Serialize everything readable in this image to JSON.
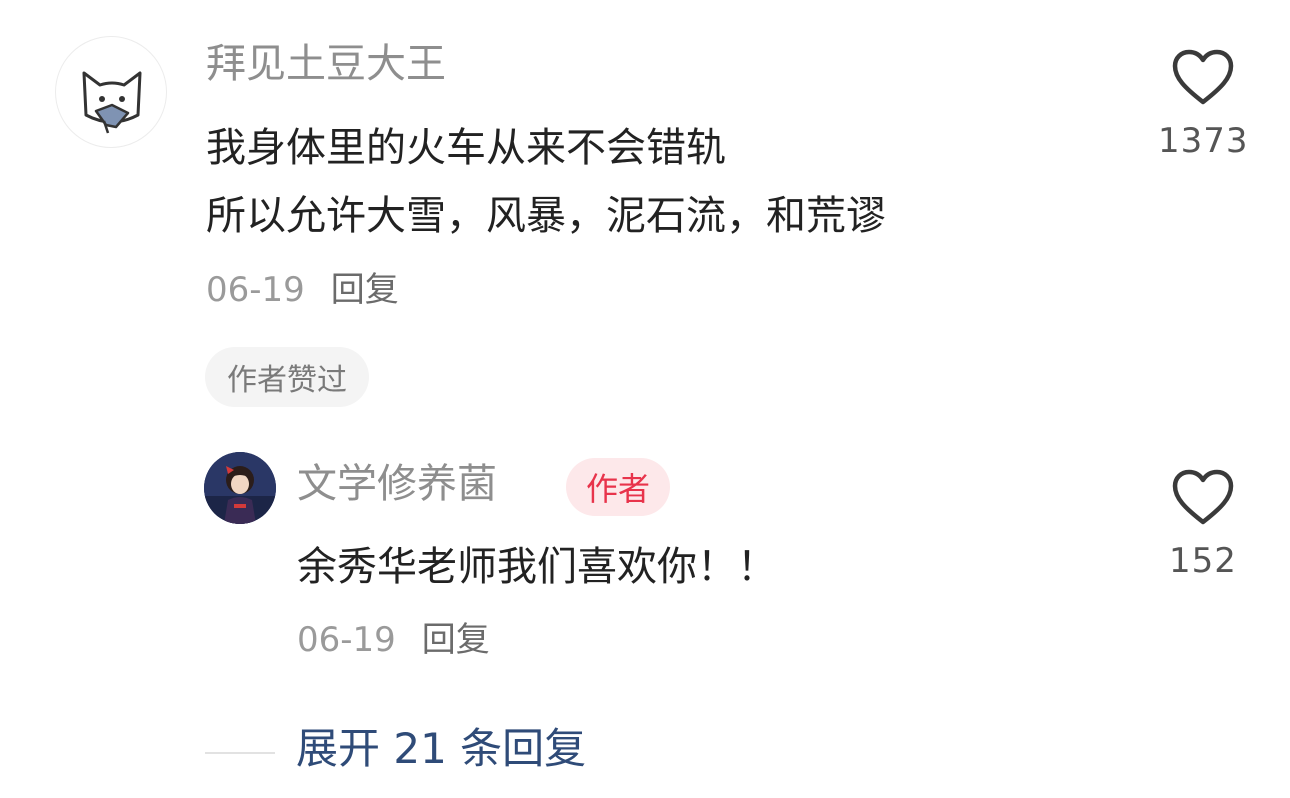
{
  "comment": {
    "username": "拜见土豆大王",
    "text_line1": "我身体里的火车从来不会错轨",
    "text_line2": "所以允许大雪，风暴，泥石流，和荒谬",
    "date": "06-19",
    "reply_label": "回复",
    "author_liked_badge": "作者赞过",
    "like_count": "1373",
    "avatar_icon": "cat-holding-fish-avatar",
    "like_icon": "heart-outline-icon"
  },
  "reply": {
    "username": "文学修养菌",
    "author_tag": "作者",
    "author_tag_color": "#e8334b",
    "text": "余秀华老师我们喜欢你！！",
    "date": "06-19",
    "reply_label": "回复",
    "like_count": "152",
    "avatar_icon": "anime-girl-avatar",
    "like_icon": "heart-outline-icon"
  },
  "expand": {
    "label": "展开 21 条回复",
    "color": "#2f4b78"
  }
}
